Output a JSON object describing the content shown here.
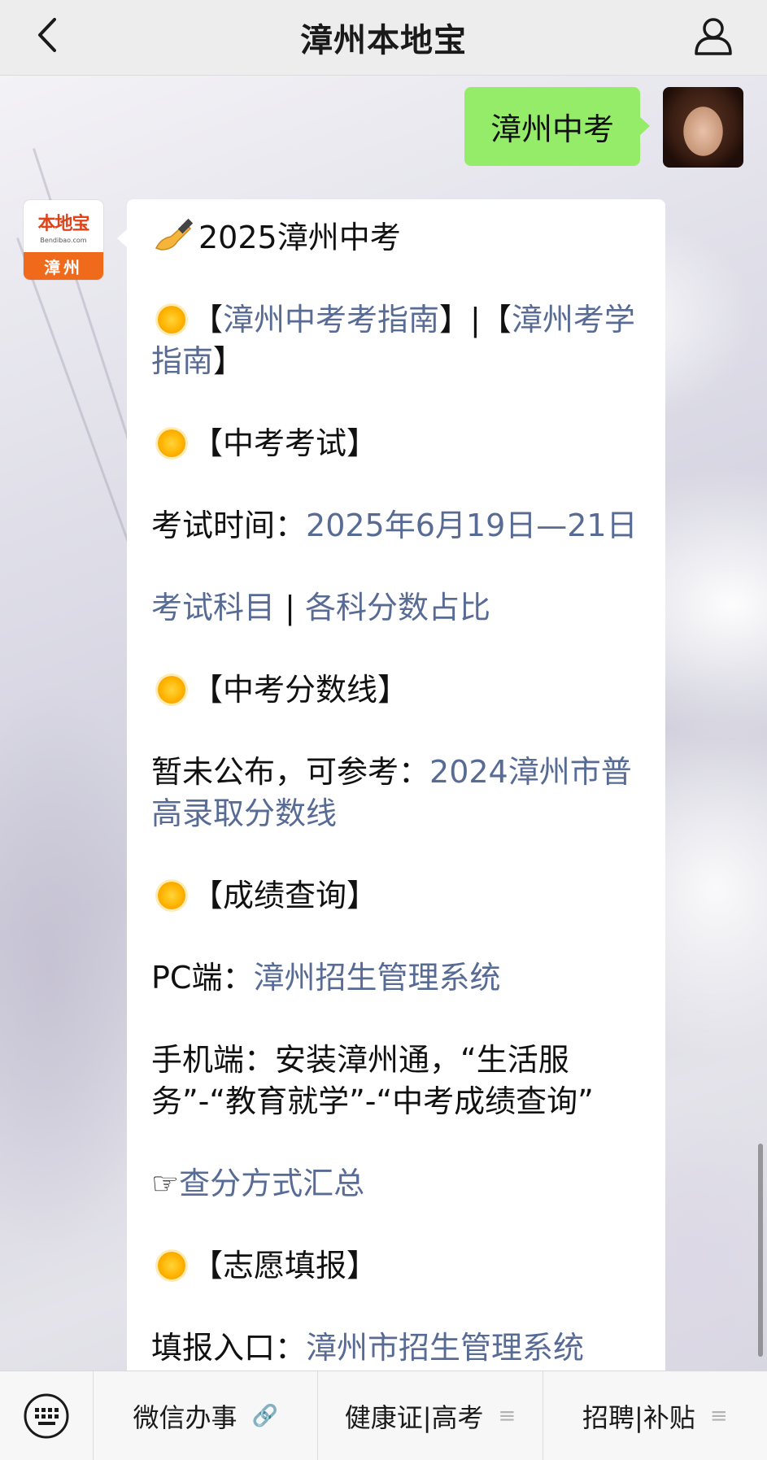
{
  "nav": {
    "title": "漳州本地宝",
    "back_icon": "chevron-left-icon",
    "profile_icon": "person-icon"
  },
  "outgoing": {
    "text": "漳州中考"
  },
  "bot": {
    "logo_text": "本地宝",
    "logo_small": "Bendibao.com",
    "city": "漳州"
  },
  "message": {
    "heading": "2025漳州中考",
    "guide_open": "【",
    "guide_link1": "漳州中考考指南",
    "guide_sep": "】|【",
    "guide_link2": "漳州考学指南",
    "guide_close": "】",
    "sec_exam": "【中考考试】",
    "exam_time_label": "考试时间：",
    "exam_time_link": "2025年6月19日—21日",
    "subjects_link": "考试科目",
    "subjects_sep": " | ",
    "scores_link": "各科分数占比",
    "sec_cutoff": "【中考分数线】",
    "cutoff_text": "暂未公布，可参考：",
    "cutoff_link": "2024漳州市普高录取分数线",
    "sec_results": "【成绩查询】",
    "pc_label": "PC端：",
    "pc_link": "漳州招生管理系统",
    "mobile_text": "手机端：安装漳州通，“生活服务”-“教育就学”-“中考成绩查询”",
    "hand": "☞",
    "query_link": "查分方式汇总",
    "sec_volunteer": "【志愿填报】",
    "entry_label": "填报入口：",
    "entry_link": "漳州市招生管理系统"
  },
  "menu": {
    "keyboard_icon": "keyboard-icon",
    "items": [
      {
        "label": "微信办事",
        "icon": "link-icon",
        "glyph": "🔗"
      },
      {
        "label": "健康证|高考",
        "icon": "menu-lines-icon",
        "glyph": "≡"
      },
      {
        "label": "招聘|补贴",
        "icon": "menu-lines-icon",
        "glyph": "≡"
      }
    ]
  },
  "colors": {
    "link": "#576b95",
    "outgoing_bubble": "#95ec69",
    "bot_orange": "#f06a1c"
  }
}
